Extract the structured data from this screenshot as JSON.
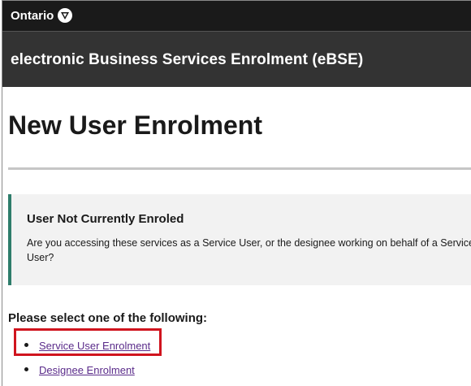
{
  "header": {
    "brand": "Ontario",
    "brand_icon": "trillium-logo-icon"
  },
  "app": {
    "title": "electronic Business Services Enrolment (eBSE)"
  },
  "page": {
    "title": "New User Enrolment"
  },
  "notice": {
    "title": "User Not Currently Enroled",
    "body": "Are you accessing these services as a Service User, or the designee working on behalf of a Service User?",
    "accent_color": "#2e7d6b"
  },
  "selection": {
    "prompt": "Please select one of the following:",
    "options": [
      {
        "label": "Service User Enrolment",
        "highlighted": true
      },
      {
        "label": "Designee Enrolment",
        "highlighted": false
      }
    ]
  },
  "colors": {
    "topbar": "#1a1a1a",
    "subbar": "#333333",
    "link": "#5a2b8a",
    "highlight_box": "#d0141e"
  }
}
